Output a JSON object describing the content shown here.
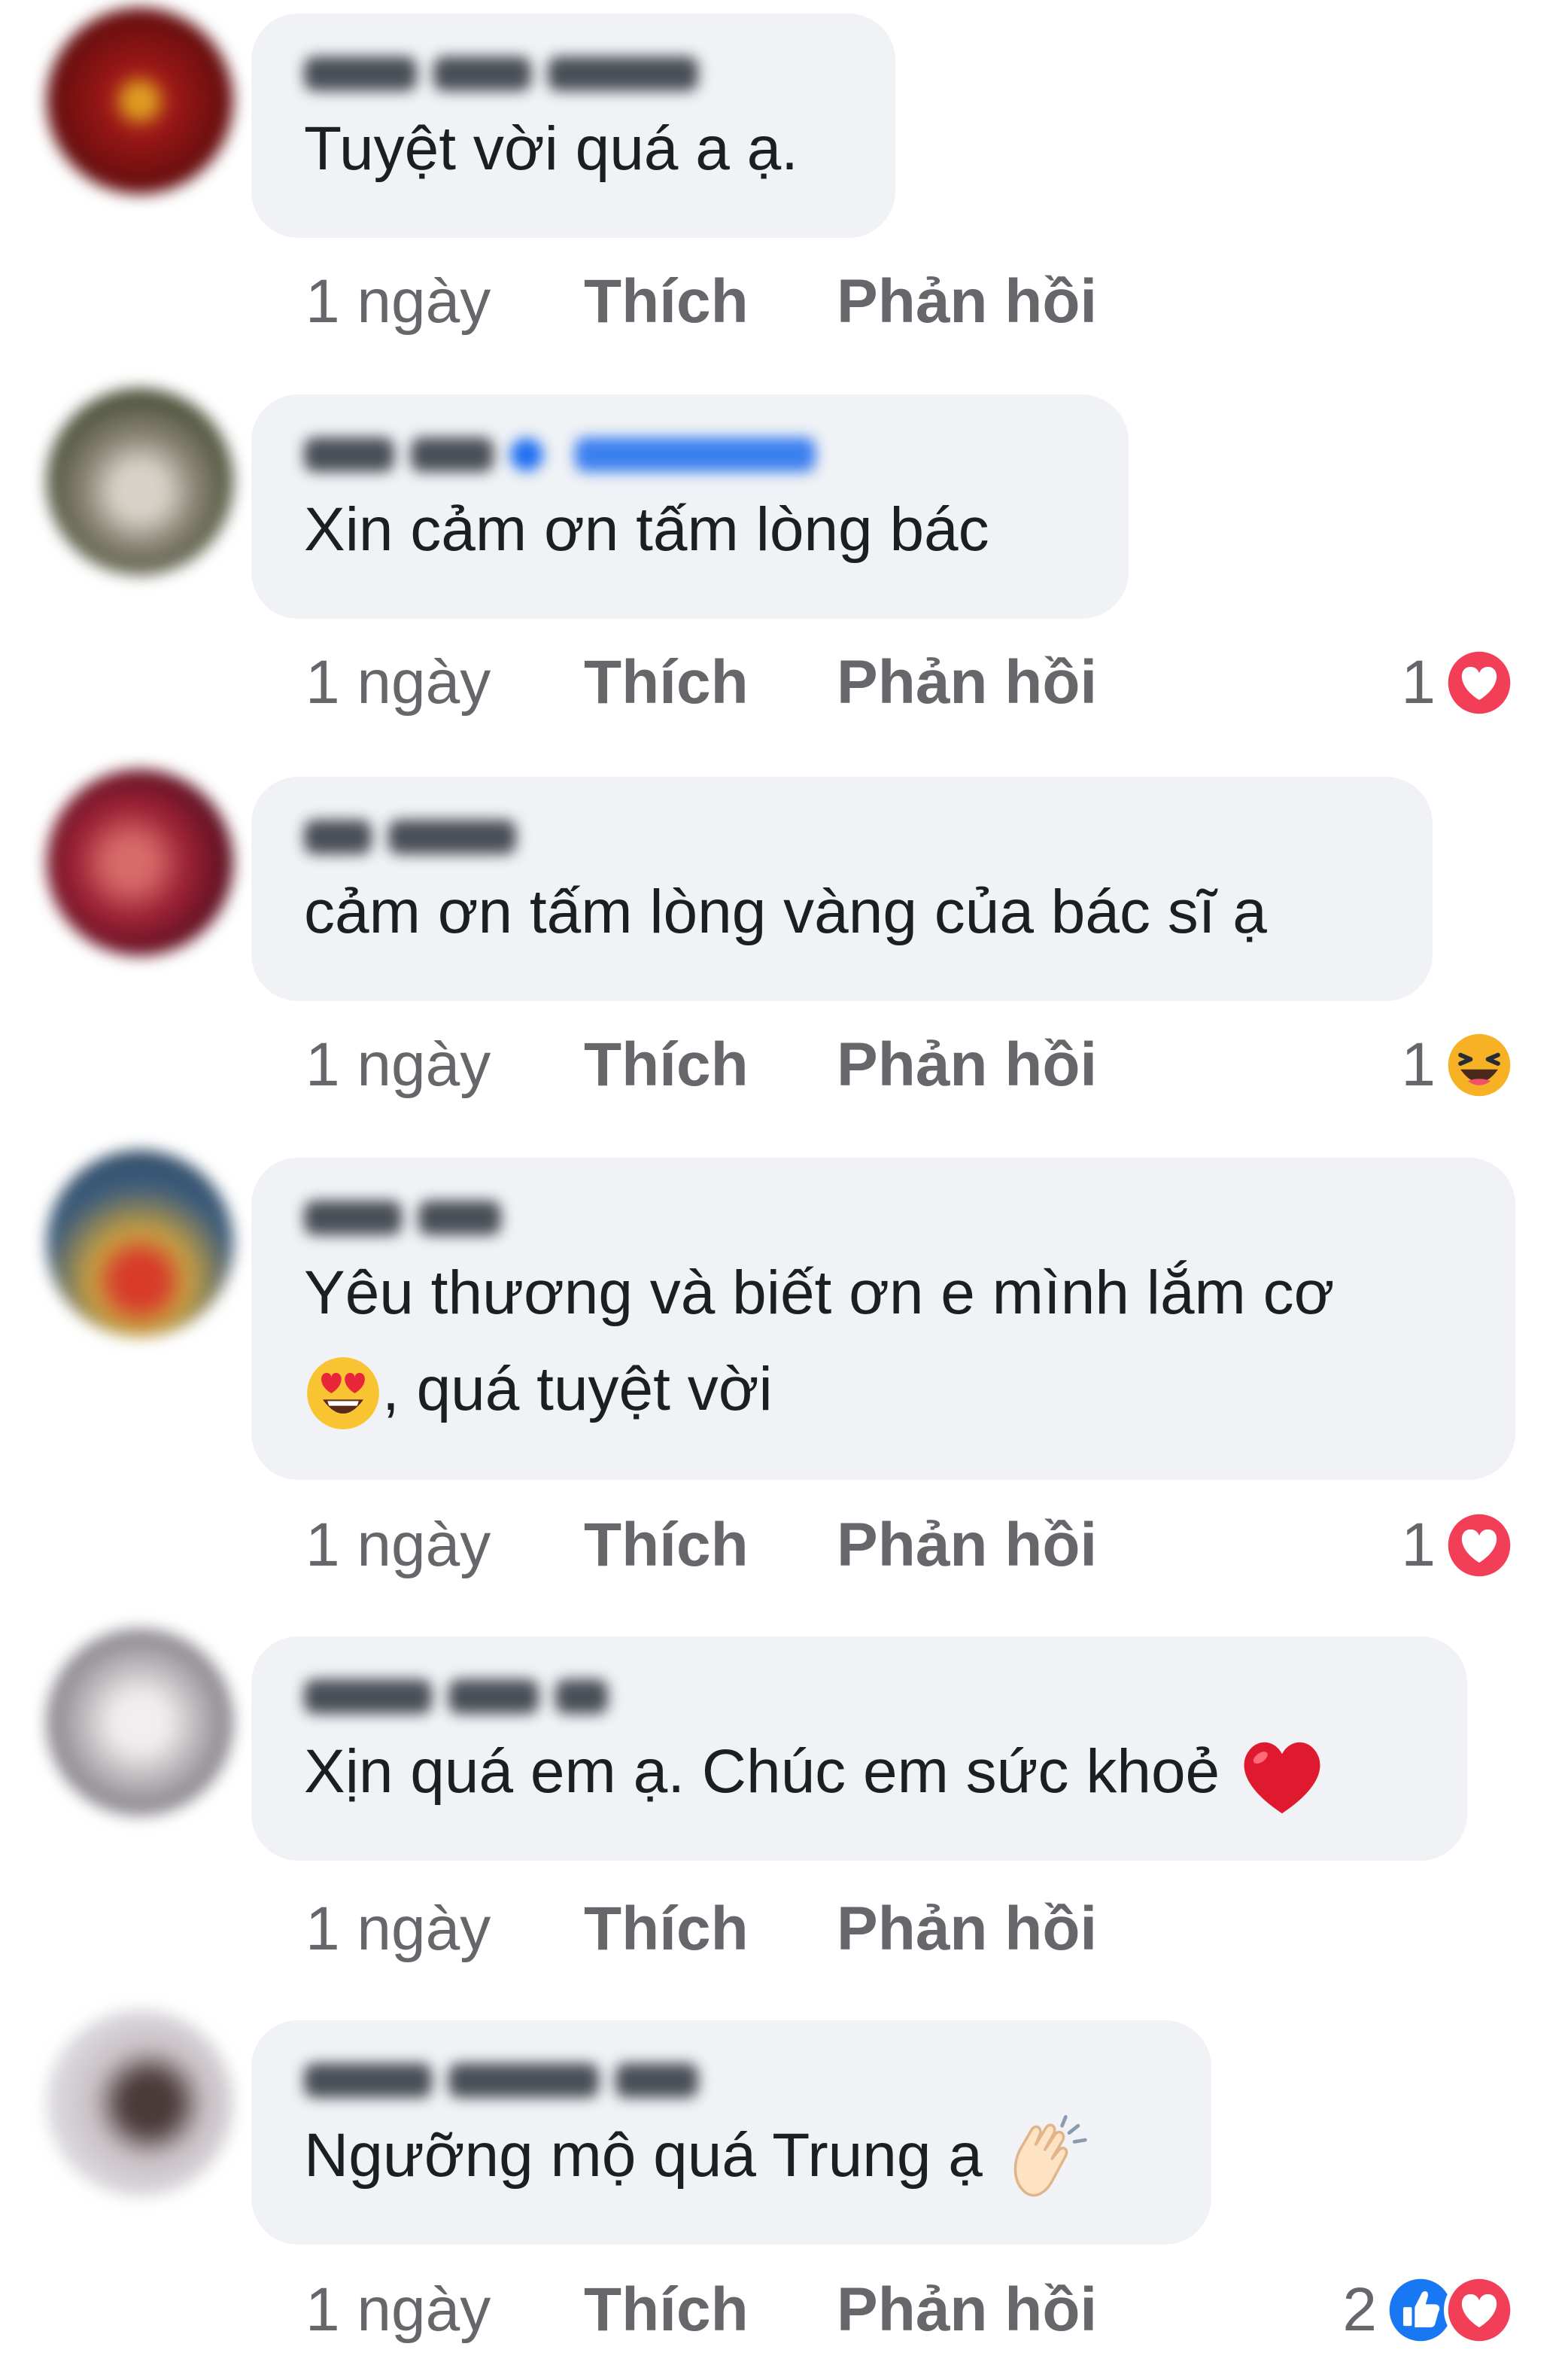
{
  "comments": [
    {
      "text": "Tuyệt vời quá a ạ.",
      "time": "1 ngày",
      "like_label": "Thích",
      "reply_label": "Phản hồi"
    },
    {
      "text": "Xin cảm ơn tấm lòng bác",
      "time": "1 ngày",
      "like_label": "Thích",
      "reply_label": "Phản hồi",
      "reaction_count": "1",
      "reactions": [
        "love"
      ]
    },
    {
      "text": "cảm ơn tấm lòng vàng của bác sĩ ạ",
      "time": "1 ngày",
      "like_label": "Thích",
      "reply_label": "Phản hồi",
      "reaction_count": "1",
      "reactions": [
        "haha"
      ]
    },
    {
      "text_line1": "Yêu thương và biết ơn e mình lắm cơ",
      "text_line2": ", quá tuyệt vời",
      "inline_emoji": "heart-eyes",
      "time": "1 ngày",
      "like_label": "Thích",
      "reply_label": "Phản hồi",
      "reaction_count": "1",
      "reactions": [
        "love"
      ]
    },
    {
      "text": "Xịn quá em ạ. Chúc em sức khoẻ",
      "inline_emoji": "red-heart",
      "time": "1 ngày",
      "like_label": "Thích",
      "reply_label": "Phản hồi"
    },
    {
      "text": "Ngưỡng mộ quá Trung ạ",
      "inline_emoji": "clapping-hands",
      "time": "1 ngày",
      "like_label": "Thích",
      "reply_label": "Phản hồi",
      "reaction_count": "2",
      "reactions": [
        "like",
        "love"
      ]
    }
  ],
  "colors": {
    "bubble": "#f0f2f5",
    "secondary_text": "#65676b",
    "love": "#f33e58",
    "like": "#1877f2",
    "haha": "#f7b125"
  }
}
